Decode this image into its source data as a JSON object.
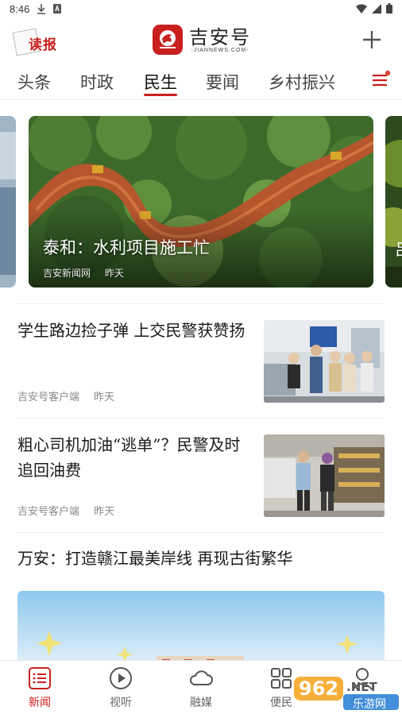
{
  "status_bar": {
    "time": "8:46"
  },
  "header": {
    "reader_label": "读报",
    "brand_name": "吉安号",
    "brand_sub": "-JIANNEWS.COM-"
  },
  "tabs": [
    {
      "label": "头条",
      "active": false
    },
    {
      "label": "时政",
      "active": false
    },
    {
      "label": "民生",
      "active": true
    },
    {
      "label": "要闻",
      "active": false
    },
    {
      "label": "乡村振兴",
      "active": false
    }
  ],
  "carousel": {
    "title": "泰和：水利项目施工忙",
    "source": "吉安新闻网",
    "time": "昨天",
    "peek_right_char": "吕"
  },
  "news": [
    {
      "title": "学生路边捡子弹 上交民警获赞扬",
      "source": "吉安号客户端",
      "time": "昨天"
    },
    {
      "title": "粗心司机加油“逃单”？民警及时追回油费",
      "source": "吉安号客户端",
      "time": "昨天"
    },
    {
      "title": "万安：打造赣江最美岸线 再现古街繁华"
    }
  ],
  "bottom_nav": [
    {
      "label": "新闻",
      "icon": "list-icon",
      "active": true
    },
    {
      "label": "视听",
      "icon": "play-icon",
      "active": false
    },
    {
      "label": "融媒",
      "icon": "cloud-icon",
      "active": false
    },
    {
      "label": "便民",
      "icon": "grid-icon",
      "active": false
    },
    {
      "label": "我的",
      "icon": "user-icon",
      "active": false
    }
  ],
  "watermark": {
    "top": "962",
    "suffix": ".NET",
    "bottom": "乐游网"
  },
  "colors": {
    "accent": "#c8201e",
    "text": "#1a1a1a",
    "meta": "#888888"
  }
}
